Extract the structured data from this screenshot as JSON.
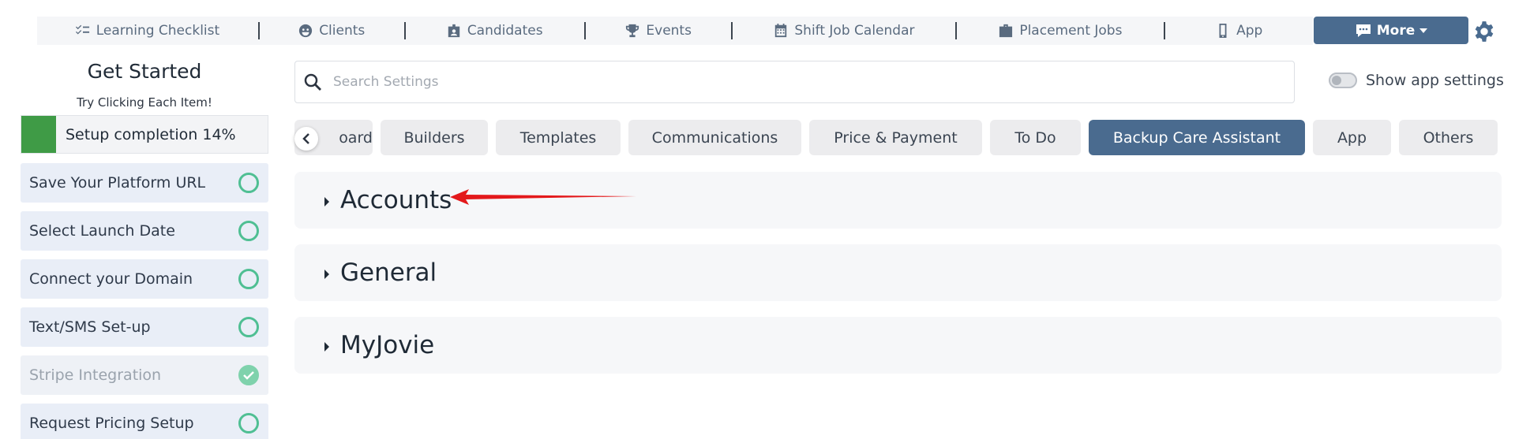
{
  "nav": {
    "items": [
      {
        "label": "Learning Checklist",
        "icon": "checklist-icon"
      },
      {
        "label": "Clients",
        "icon": "face-icon"
      },
      {
        "label": "Candidates",
        "icon": "badge-icon"
      },
      {
        "label": "Events",
        "icon": "trophy-icon"
      },
      {
        "label": "Shift Job Calendar",
        "icon": "calendar-icon"
      },
      {
        "label": "Placement Jobs",
        "icon": "briefcase-icon"
      },
      {
        "label": "App",
        "icon": "phone-icon"
      }
    ],
    "more_label": "More"
  },
  "sidebar": {
    "title": "Get Started",
    "subtitle": "Try Clicking Each Item!",
    "progress_label": "Setup completion 14%",
    "progress_value": 0.14,
    "items": [
      {
        "label": "Save Your Platform URL",
        "done": false
      },
      {
        "label": "Select Launch Date",
        "done": false
      },
      {
        "label": "Connect your Domain",
        "done": false
      },
      {
        "label": "Text/SMS Set-up",
        "done": false
      },
      {
        "label": "Stripe Integration",
        "done": true
      },
      {
        "label": "Request Pricing Setup",
        "done": false
      }
    ]
  },
  "search": {
    "placeholder": "Search Settings",
    "value": ""
  },
  "toggle": {
    "label": "Show app settings",
    "on": false
  },
  "tabs": [
    {
      "label": "oard",
      "active": false
    },
    {
      "label": "Builders",
      "active": false
    },
    {
      "label": "Templates",
      "active": false
    },
    {
      "label": "Communications",
      "active": false
    },
    {
      "label": "Price & Payment",
      "active": false
    },
    {
      "label": "To Do",
      "active": false
    },
    {
      "label": "Backup Care Assistant",
      "active": true
    },
    {
      "label": "App",
      "active": false
    },
    {
      "label": "Others",
      "active": false
    }
  ],
  "sections": [
    {
      "title": "Accounts"
    },
    {
      "title": "General"
    },
    {
      "title": "MyJovie"
    }
  ],
  "colors": {
    "accent": "#4a6b8f",
    "progress": "#3f9b46",
    "check": "#4fbf93",
    "annotation_arrow": "#e3191b"
  }
}
